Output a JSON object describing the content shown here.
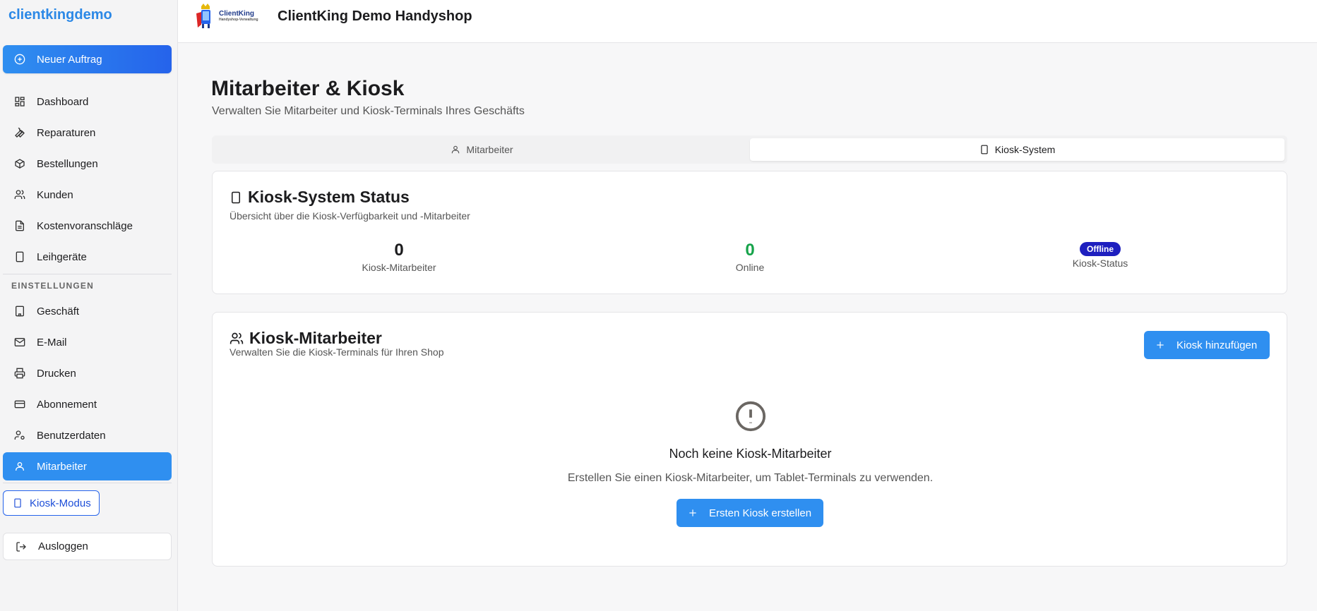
{
  "sidebar": {
    "brand": "clientkingdemo",
    "new_order": "Neuer Auftrag",
    "items": [
      {
        "label": "Dashboard",
        "icon": "dashboard-icon"
      },
      {
        "label": "Reparaturen",
        "icon": "wrench-icon"
      },
      {
        "label": "Bestellungen",
        "icon": "package-icon"
      },
      {
        "label": "Kunden",
        "icon": "users-icon"
      },
      {
        "label": "Kostenvoranschläge",
        "icon": "file-text-icon"
      },
      {
        "label": "Leihgeräte",
        "icon": "tablet-icon"
      }
    ],
    "settings_label": "EINSTELLUNGEN",
    "settings_items": [
      {
        "label": "Geschäft",
        "icon": "building-icon"
      },
      {
        "label": "E-Mail",
        "icon": "mail-icon"
      },
      {
        "label": "Drucken",
        "icon": "printer-icon"
      },
      {
        "label": "Abonnement",
        "icon": "credit-card-icon"
      },
      {
        "label": "Benutzerdaten",
        "icon": "user-cog-icon"
      },
      {
        "label": "Mitarbeiter",
        "icon": "user-icon",
        "active": true
      }
    ],
    "kiosk_mode": "Kiosk-Modus",
    "logout": "Ausloggen"
  },
  "header": {
    "logo_text": "ClientKing",
    "logo_subtext": "Handyshop-Verwaltung",
    "shop_title": "ClientKing Demo Handyshop"
  },
  "main": {
    "title": "Mitarbeiter & Kiosk",
    "subtitle": "Verwalten Sie Mitarbeiter und Kiosk-Terminals Ihres Geschäfts",
    "tabs": [
      {
        "label": "Mitarbeiter",
        "selected": false
      },
      {
        "label": "Kiosk-System",
        "selected": true
      }
    ],
    "status_card": {
      "title": "Kiosk-System Status",
      "description": "Übersicht über die Kiosk-Verfügbarkeit und -Mitarbeiter",
      "stats": {
        "employees_value": "0",
        "employees_label": "Kiosk-Mitarbeiter",
        "online_value": "0",
        "online_label": "Online",
        "status_badge": "Offline",
        "status_label": "Kiosk-Status"
      }
    },
    "employees_card": {
      "title": "Kiosk-Mitarbeiter",
      "description": "Verwalten Sie die Kiosk-Terminals für Ihren Shop",
      "add_button": "Kiosk hinzufügen",
      "empty_title": "Noch keine Kiosk-Mitarbeiter",
      "empty_description": "Erstellen Sie einen Kiosk-Mitarbeiter, um Tablet-Terminals zu verwenden.",
      "create_button": "Ersten Kiosk erstellen"
    }
  },
  "colors": {
    "accent": "#2f8ff0",
    "brand": "#2b88e6",
    "online_green": "#16a34a",
    "offline_badge": "#1e1fbf"
  }
}
